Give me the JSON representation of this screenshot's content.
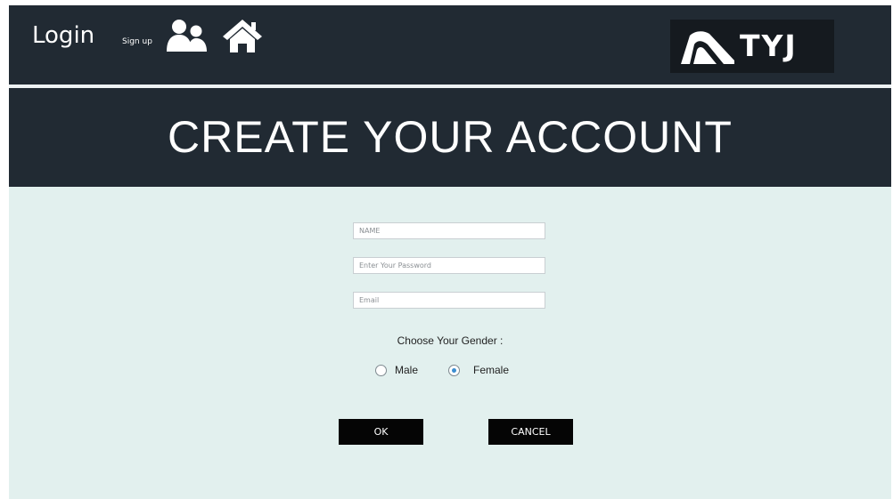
{
  "header": {
    "login_label": "Login",
    "signup_label": "Sign up",
    "users_icon": "users-icon",
    "home_icon": "home-icon",
    "logo_text": "TYJ"
  },
  "page": {
    "title": "CREATE YOUR ACCOUNT"
  },
  "form": {
    "name_placeholder": "NAME",
    "password_placeholder": "Enter Your Password",
    "email_placeholder": "Email",
    "name_value": "",
    "password_value": "",
    "email_value": "",
    "gender_label": "Choose Your Gender :",
    "gender_options": [
      {
        "label": "Male",
        "selected": false
      },
      {
        "label": "Female",
        "selected": true
      }
    ],
    "ok_label": "OK",
    "cancel_label": "CANCEL"
  },
  "colors": {
    "header_bg": "#212a33",
    "body_bg": "#e2f0ee",
    "button_bg": "#050505",
    "radio_accent": "#3d8fd1"
  }
}
